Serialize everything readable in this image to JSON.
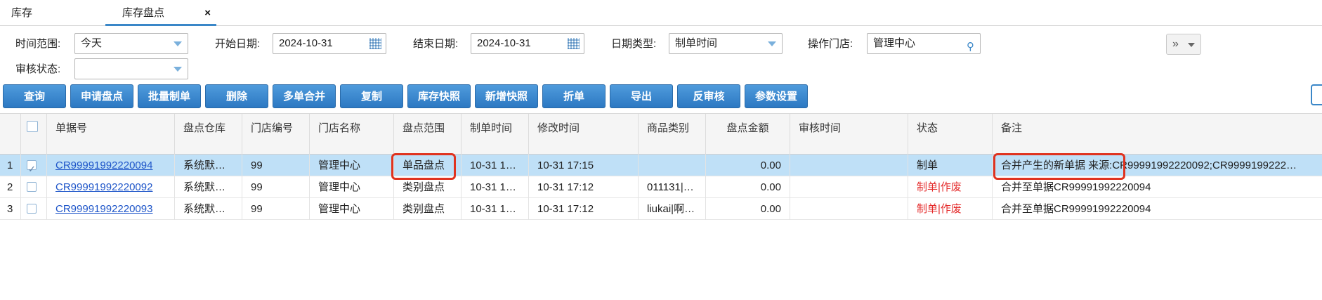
{
  "tabs": [
    {
      "label": "库存"
    },
    {
      "label": "库存盘点",
      "close": "×"
    }
  ],
  "filters": {
    "time_range_label": "时间范围:",
    "time_range_value": "今天",
    "start_date_label": "开始日期:",
    "start_date_value": "2024-10-31",
    "end_date_label": "结束日期:",
    "end_date_value": "2024-10-31",
    "date_type_label": "日期类型:",
    "date_type_value": "制单时间",
    "store_label": "操作门店:",
    "store_value": "管理中心",
    "audit_label": "审核状态:",
    "audit_value": "",
    "more_label": "»"
  },
  "toolbar": [
    "查询",
    "申请盘点",
    "批量制单",
    "删除",
    "多单合并",
    "复制",
    "库存快照",
    "新增快照",
    "折单",
    "导出",
    "反审核",
    "参数设置"
  ],
  "table": {
    "headers": [
      "单据号",
      "盘点仓库",
      "门店编号",
      "门店名称",
      "盘点范围",
      "制单时间",
      "修改时间",
      "商品类别",
      "盘点金额",
      "审核时间",
      "状态",
      "备注"
    ],
    "rows": [
      {
        "rn": "1",
        "checked": true,
        "doc": "CR99991992220094",
        "warehouse": "系统默…",
        "store_no": "99",
        "store_name": "管理中心",
        "scope": "单品盘点",
        "created": "10-31 1…",
        "modified": "10-31 17:15",
        "category": "",
        "amount": "0.00",
        "audit_time": "",
        "status": "制单",
        "note": "合并产生的新单据 来源:CR99991992220092;CR9999199222…"
      },
      {
        "rn": "2",
        "checked": false,
        "doc": "CR99991992220092",
        "warehouse": "系统默…",
        "store_no": "99",
        "store_name": "管理中心",
        "scope": "类别盘点",
        "created": "10-31 1…",
        "modified": "10-31 17:12",
        "category": "011131|…",
        "amount": "0.00",
        "audit_time": "",
        "status": "制单|作废",
        "note": "合并至单据CR99991992220094"
      },
      {
        "rn": "3",
        "checked": false,
        "doc": "CR99991992220093",
        "warehouse": "系统默…",
        "store_no": "99",
        "store_name": "管理中心",
        "scope": "类别盘点",
        "created": "10-31 1…",
        "modified": "10-31 17:12",
        "category": "liukai|啊…",
        "amount": "0.00",
        "audit_time": "",
        "status": "制单|作废",
        "note": "合并至单据CR99991992220094"
      }
    ]
  },
  "colors": {
    "accent": "#3a87c8",
    "highlight": "#e0331f",
    "selected_row": "#bfe0f7",
    "void_status": "#e42b2b"
  }
}
